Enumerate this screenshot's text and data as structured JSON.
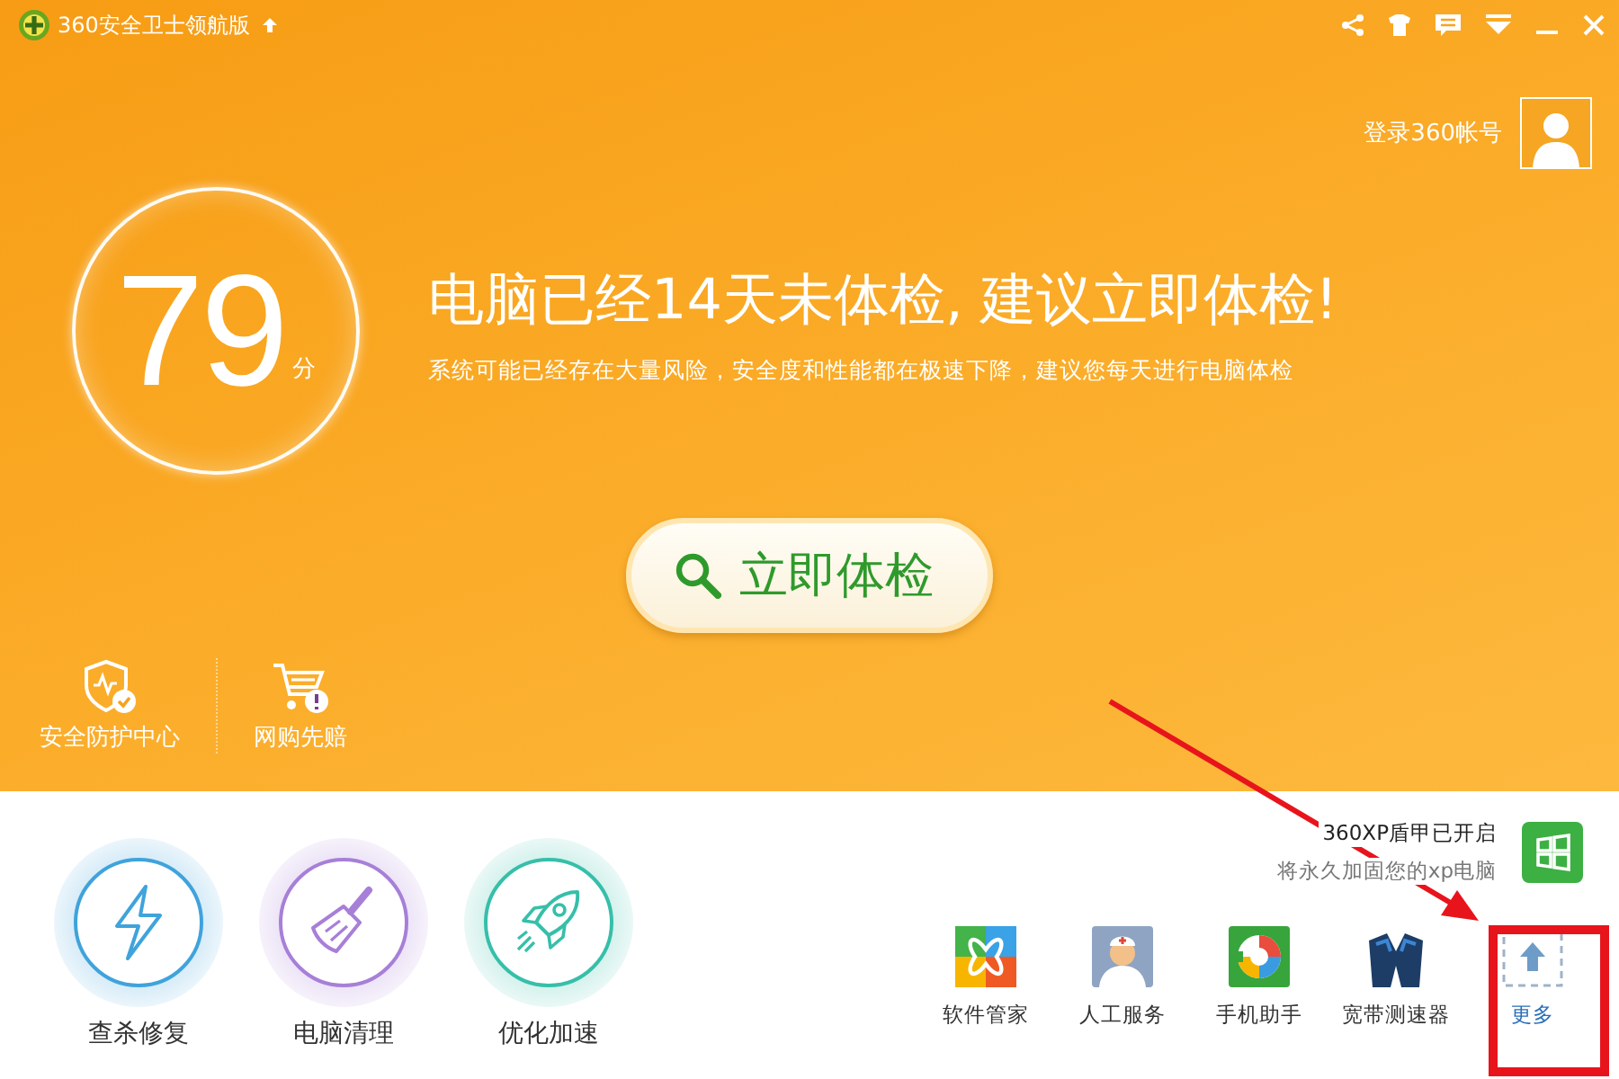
{
  "window": {
    "title": "360安全卫士领航版"
  },
  "account": {
    "login_label": "登录360帐号"
  },
  "score": {
    "value": "79",
    "unit": "分"
  },
  "headline": "电脑已经14天未体检, 建议立即体检!",
  "subtitle": "系统可能已经存在大量风险，安全度和性能都在极速下降，建议您每天进行电脑体检",
  "scan_button": {
    "label": "立即体检"
  },
  "hero_links": [
    {
      "label": "安全防护中心",
      "kind": "shield"
    },
    {
      "label": "网购先赔",
      "kind": "cart"
    }
  ],
  "tools": [
    {
      "label": "查杀修复",
      "kind": "bolt",
      "color": "#3fa3dc"
    },
    {
      "label": "电脑清理",
      "kind": "broom",
      "color": "#a77fd8"
    },
    {
      "label": "优化加速",
      "kind": "rocket",
      "color": "#36bfa9"
    }
  ],
  "xp_notice": {
    "title": "360XP盾甲已开启",
    "subtitle": "将永久加固您的xp电脑"
  },
  "apps": [
    {
      "label": "软件管家",
      "kind": "software"
    },
    {
      "label": "人工服务",
      "kind": "service"
    },
    {
      "label": "手机助手",
      "kind": "phone"
    },
    {
      "label": "宽带测速器",
      "kind": "speed"
    },
    {
      "label": "更多",
      "kind": "more"
    }
  ]
}
